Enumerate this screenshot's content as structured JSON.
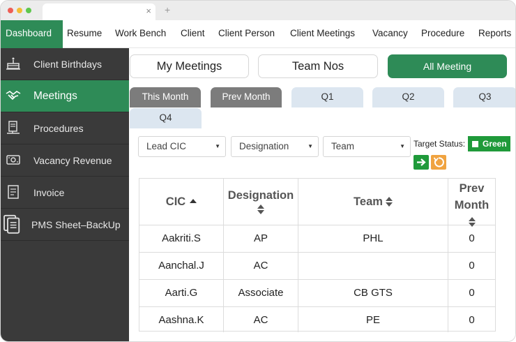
{
  "browser": {
    "tab_close": "×",
    "tab_new": "+"
  },
  "topnav": {
    "items": [
      "Dashboard",
      "Resume",
      "Work Bench",
      "Client",
      "Client Person",
      "Client Meetings",
      "Vacancy",
      "Procedure",
      "Reports"
    ],
    "active": "Dashboard",
    "accent": "#2e8b57"
  },
  "sidebar": {
    "items": [
      {
        "label": "Client Birthdays",
        "icon": "cake-icon"
      },
      {
        "label": "Meetings",
        "icon": "handshake-icon"
      },
      {
        "label": "Procedures",
        "icon": "procedure-document-icon"
      },
      {
        "label": "Vacancy Revenue",
        "icon": "money-icon"
      },
      {
        "label": "Invoice",
        "icon": "invoice-icon"
      },
      {
        "label": "PMS Sheet–BackUp",
        "icon": "documents-icon"
      }
    ],
    "active": "Meetings"
  },
  "main": {
    "tabs": [
      "My Meetings",
      "Team Nos",
      "All Meeting"
    ],
    "active_tab": "All Meeting",
    "periods": [
      "This Month",
      "Prev Month",
      "Q1",
      "Q2",
      "Q3",
      "Q4"
    ],
    "filters": {
      "lead_cic": "Lead CIC",
      "designation": "Designation",
      "team": "Team"
    },
    "target_status_label": "Target Status:",
    "target_status_value": "Green",
    "table": {
      "columns": [
        "CIC",
        "Designation",
        "Team",
        "Prev Month"
      ],
      "rows": [
        [
          "Aakriti.S",
          "AP",
          "PHL",
          "0"
        ],
        [
          "Aanchal.J",
          "AC",
          "",
          "0"
        ],
        [
          "Aarti.G",
          "Associate",
          "CB GTS",
          "0"
        ],
        [
          "Aashna.K",
          "AC",
          "PE",
          "0"
        ]
      ]
    }
  }
}
